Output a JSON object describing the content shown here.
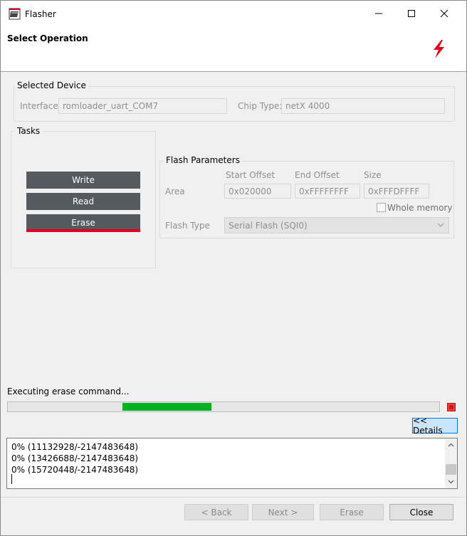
{
  "window": {
    "title": "Flasher"
  },
  "header": {
    "title": "Select Operation"
  },
  "device": {
    "group_title": "Selected Device",
    "interface_label": "Interface:",
    "interface_value": "romloader_uart_COM7",
    "chip_label": "Chip Type:",
    "chip_value": "netX 4000"
  },
  "tasks": {
    "group_title": "Tasks",
    "items": [
      {
        "label": "Write",
        "active": false
      },
      {
        "label": "Read",
        "active": false
      },
      {
        "label": "Erase",
        "active": true
      }
    ]
  },
  "flash_params": {
    "group_title": "Flash Parameters",
    "col_start": "Start Offset",
    "col_end": "End Offset",
    "col_size": "Size",
    "area_label": "Area",
    "start_value": "0x020000",
    "end_value": "0xFFFFFFFF",
    "size_value": "0xFFFDFFFF",
    "whole_memory_label": "Whole memory",
    "whole_memory_checked": false,
    "flash_type_label": "Flash Type",
    "flash_type_value": "Serial Flash (SQI0)"
  },
  "progress": {
    "status": "Executing erase command...",
    "fill_start_fraction": 0.265,
    "fill_end_fraction": 0.472,
    "fill_color": "#06b025",
    "details_label": "<< Details"
  },
  "log": {
    "lines": [
      "0% (11132928/-2147483648)",
      "0% (13426688/-2147483648)",
      "0% (15720448/-2147483648)"
    ]
  },
  "footer": {
    "back_label": "< Back",
    "next_label": "Next >",
    "erase_label": "Erase",
    "close_label": "Close"
  },
  "colors": {
    "accent_red": "#e1001e",
    "task_button": "#545a5f"
  }
}
